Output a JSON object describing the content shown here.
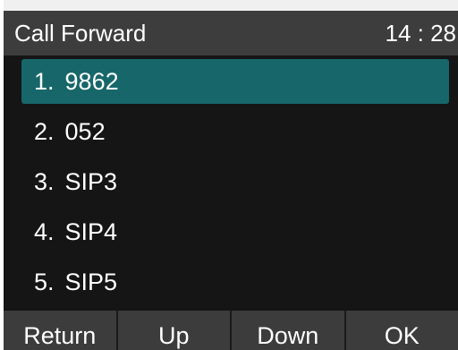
{
  "header": {
    "title": "Call Forward",
    "time": "14 : 28"
  },
  "list": {
    "items": [
      {
        "number": "1.",
        "label": "9862",
        "selected": true
      },
      {
        "number": "2.",
        "label": "052",
        "selected": false
      },
      {
        "number": "3.",
        "label": "SIP3",
        "selected": false
      },
      {
        "number": "4.",
        "label": "SIP4",
        "selected": false
      },
      {
        "number": "5.",
        "label": "SIP5",
        "selected": false
      }
    ]
  },
  "softkeys": {
    "return_label": "Return",
    "up_label": "Up",
    "down_label": "Down",
    "ok_label": "OK"
  },
  "colors": {
    "selection": "#17676a",
    "header_bg": "#3d3d3d",
    "list_bg": "#151515",
    "softkey_bg": "#3c3c3c"
  }
}
